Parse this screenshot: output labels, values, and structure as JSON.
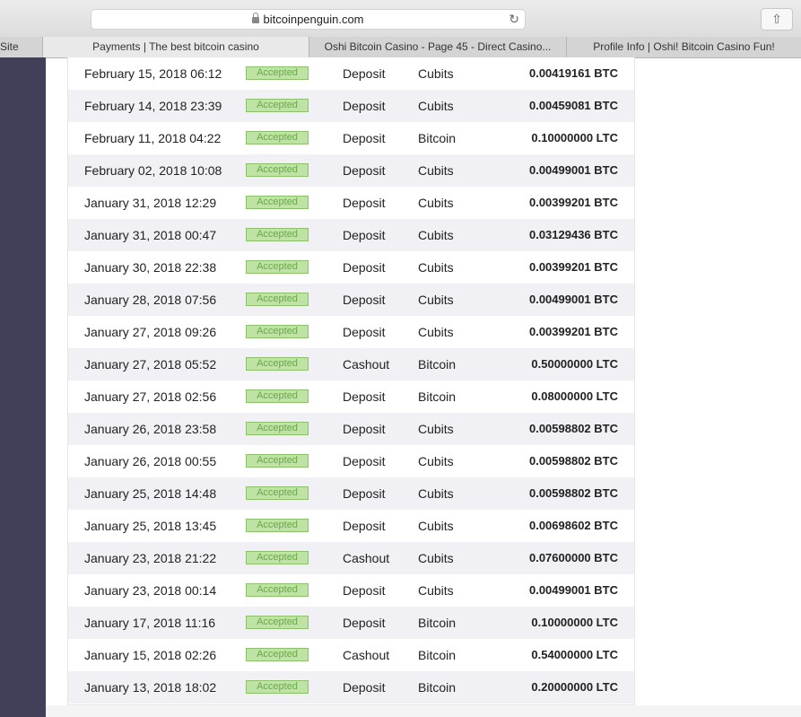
{
  "browser": {
    "url": "bitcoinpenguin.com",
    "tabs": [
      {
        "label": "Site"
      },
      {
        "label": "Payments | The best bitcoin casino"
      },
      {
        "label": "Oshi Bitcoin Casino - Page 45 - Direct Casino..."
      },
      {
        "label": "Profile Info | Oshi! Bitcoin Casino Fun!"
      }
    ]
  },
  "transactions": [
    {
      "date": "February 15, 2018 06:12",
      "status": "Accepted",
      "type": "Deposit",
      "method": "Cubits",
      "amount": "0.00419161 BTC"
    },
    {
      "date": "February 14, 2018 23:39",
      "status": "Accepted",
      "type": "Deposit",
      "method": "Cubits",
      "amount": "0.00459081 BTC"
    },
    {
      "date": "February 11, 2018 04:22",
      "status": "Accepted",
      "type": "Deposit",
      "method": "Bitcoin",
      "amount": "0.10000000 LTC"
    },
    {
      "date": "February 02, 2018 10:08",
      "status": "Accepted",
      "type": "Deposit",
      "method": "Cubits",
      "amount": "0.00499001 BTC"
    },
    {
      "date": "January 31, 2018 12:29",
      "status": "Accepted",
      "type": "Deposit",
      "method": "Cubits",
      "amount": "0.00399201 BTC"
    },
    {
      "date": "January 31, 2018 00:47",
      "status": "Accepted",
      "type": "Deposit",
      "method": "Cubits",
      "amount": "0.03129436 BTC"
    },
    {
      "date": "January 30, 2018 22:38",
      "status": "Accepted",
      "type": "Deposit",
      "method": "Cubits",
      "amount": "0.00399201 BTC"
    },
    {
      "date": "January 28, 2018 07:56",
      "status": "Accepted",
      "type": "Deposit",
      "method": "Cubits",
      "amount": "0.00499001 BTC"
    },
    {
      "date": "January 27, 2018 09:26",
      "status": "Accepted",
      "type": "Deposit",
      "method": "Cubits",
      "amount": "0.00399201 BTC"
    },
    {
      "date": "January 27, 2018 05:52",
      "status": "Accepted",
      "type": "Cashout",
      "method": "Bitcoin",
      "amount": "0.50000000 LTC"
    },
    {
      "date": "January 27, 2018 02:56",
      "status": "Accepted",
      "type": "Deposit",
      "method": "Bitcoin",
      "amount": "0.08000000 LTC"
    },
    {
      "date": "January 26, 2018 23:58",
      "status": "Accepted",
      "type": "Deposit",
      "method": "Cubits",
      "amount": "0.00598802 BTC"
    },
    {
      "date": "January 26, 2018 00:55",
      "status": "Accepted",
      "type": "Deposit",
      "method": "Cubits",
      "amount": "0.00598802 BTC"
    },
    {
      "date": "January 25, 2018 14:48",
      "status": "Accepted",
      "type": "Deposit",
      "method": "Cubits",
      "amount": "0.00598802 BTC"
    },
    {
      "date": "January 25, 2018 13:45",
      "status": "Accepted",
      "type": "Deposit",
      "method": "Cubits",
      "amount": "0.00698602 BTC"
    },
    {
      "date": "January 23, 2018 21:22",
      "status": "Accepted",
      "type": "Cashout",
      "method": "Cubits",
      "amount": "0.07600000 BTC"
    },
    {
      "date": "January 23, 2018 00:14",
      "status": "Accepted",
      "type": "Deposit",
      "method": "Cubits",
      "amount": "0.00499001 BTC"
    },
    {
      "date": "January 17, 2018 11:16",
      "status": "Accepted",
      "type": "Deposit",
      "method": "Bitcoin",
      "amount": "0.10000000 LTC"
    },
    {
      "date": "January 15, 2018 02:26",
      "status": "Accepted",
      "type": "Cashout",
      "method": "Bitcoin",
      "amount": "0.54000000 LTC"
    },
    {
      "date": "January 13, 2018 18:02",
      "status": "Accepted",
      "type": "Deposit",
      "method": "Bitcoin",
      "amount": "0.20000000 LTC"
    }
  ],
  "colors": {
    "sidebar": "#414058",
    "row_alt": "#f0f0f5",
    "status_bg": "#bfe3a5",
    "status_text": "#6aa848"
  }
}
